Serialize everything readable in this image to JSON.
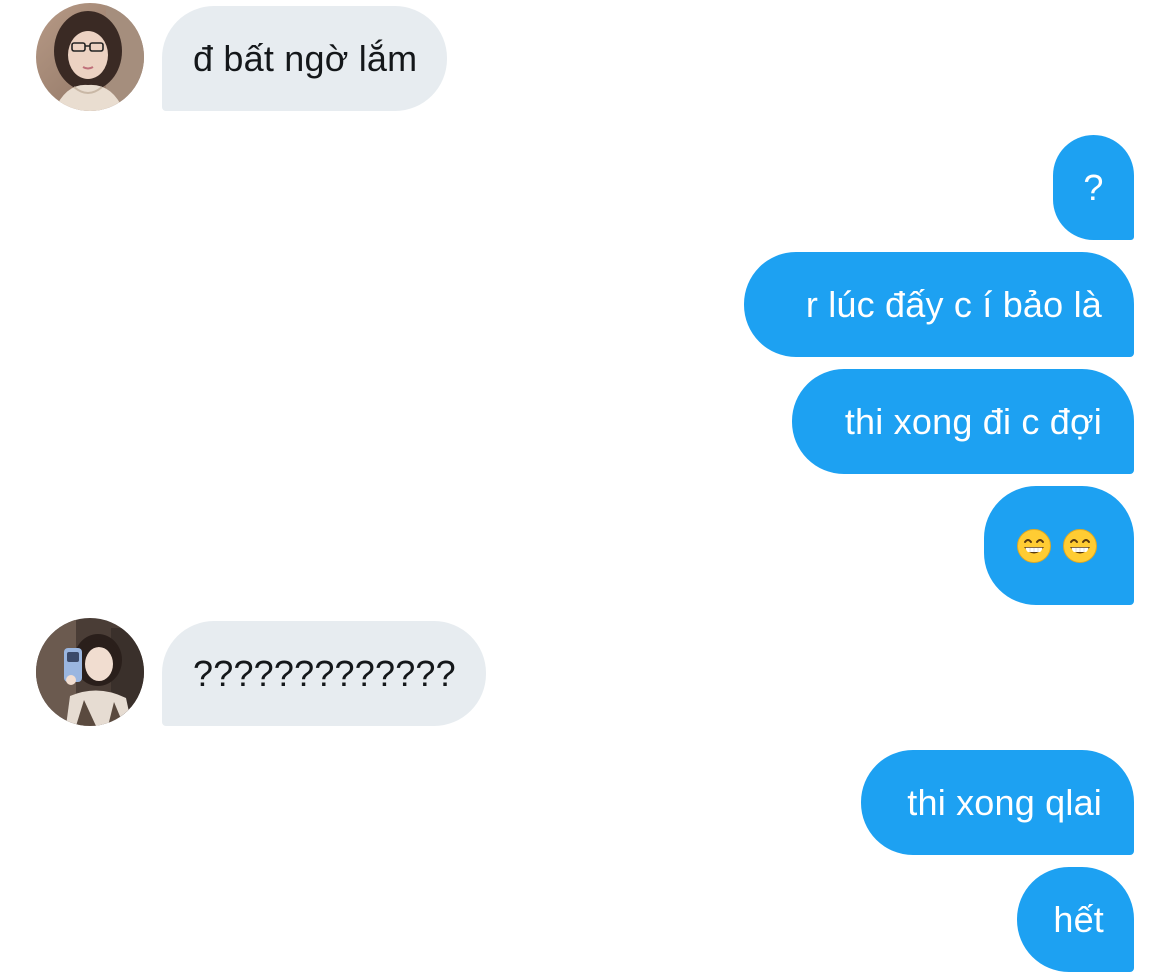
{
  "conversation": {
    "messages": [
      {
        "direction": "incoming",
        "text": "đ bất ngờ lắm"
      },
      {
        "direction": "outgoing",
        "text": "?"
      },
      {
        "direction": "outgoing",
        "text": "r lúc đấy c í bảo là"
      },
      {
        "direction": "outgoing",
        "text": "thi xong đi c đợi"
      },
      {
        "direction": "outgoing",
        "emoji": [
          "grinning-face-with-smiling-eyes",
          "grinning-face-with-smiling-eyes"
        ]
      },
      {
        "direction": "incoming",
        "text": "?????????????"
      },
      {
        "direction": "outgoing",
        "text": "thi xong qlai"
      },
      {
        "direction": "outgoing",
        "text": "hết"
      }
    ]
  },
  "colors": {
    "outgoing_bubble": "#1da1f2",
    "incoming_bubble": "#e7ecf0",
    "outgoing_text": "#ffffff",
    "incoming_text": "#14171a",
    "background": "#ffffff"
  }
}
